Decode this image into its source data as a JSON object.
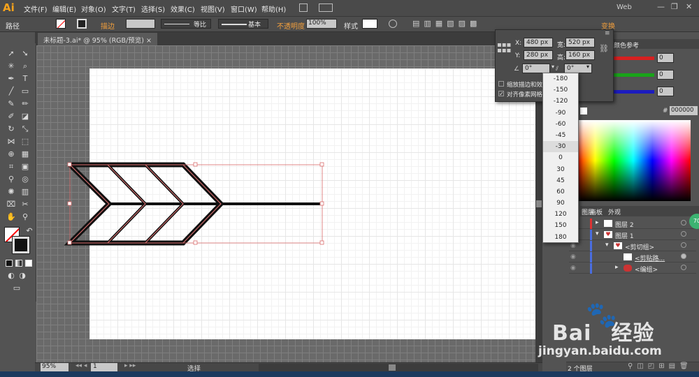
{
  "menubar": {
    "logo": "Ai",
    "items": [
      "文件(F)",
      "编辑(E)",
      "对象(O)",
      "文字(T)",
      "选择(S)",
      "效果(C)",
      "视图(V)",
      "窗口(W)",
      "帮助(H)"
    ],
    "workspace": "Web"
  },
  "control": {
    "label": "路径",
    "stroke_label": "描边",
    "stroke_style": "等比",
    "brush": "基本",
    "opacity_label": "不透明度",
    "opacity_value": "100%",
    "style_label": "样式",
    "transform_label": "变换"
  },
  "document_tab": {
    "title": "未标题-3.ai* @ 95% (RGB/预览)",
    "close": "×"
  },
  "transform": {
    "x_label": "X:",
    "x_value": "480 px",
    "w_label": "宽:",
    "w_value": "520 px",
    "y_label": "Y:",
    "y_value": "280 px",
    "h_label": "高:",
    "h_value": "160 px",
    "rotate_value": "0°",
    "shear_value": "0°",
    "check1": "缩放描边和效果",
    "check2": "对齐像素网格"
  },
  "angle_dropdown": {
    "options": [
      "-180",
      "-150",
      "-120",
      "-90",
      "-60",
      "-45",
      "-30",
      "0",
      "30",
      "45",
      "60",
      "90",
      "120",
      "150",
      "180"
    ],
    "selected": "-30"
  },
  "color": {
    "tab": "颜色参考",
    "r": "0",
    "g": "0",
    "b": "0",
    "hex_label": "#",
    "hex": "000000",
    "colors": {
      "red": "#d62020",
      "green": "#19a319",
      "blue": "#1c1cbf"
    }
  },
  "layers": {
    "tabs": [
      "图层",
      "画板",
      "外观"
    ],
    "rows": [
      {
        "name": "图层 2"
      },
      {
        "name": "图层 1"
      },
      {
        "name": "<剪切组>"
      },
      {
        "name": "<剪贴路..."
      },
      {
        "name": "<编组>"
      }
    ],
    "count": "2 个图层",
    "badge": "70"
  },
  "status": {
    "zoom": "95%",
    "page": "1",
    "mode": "选择"
  },
  "watermark": {
    "brand": "Bai",
    "brand2": "经验",
    "url": "jingyan.baidu.com"
  }
}
